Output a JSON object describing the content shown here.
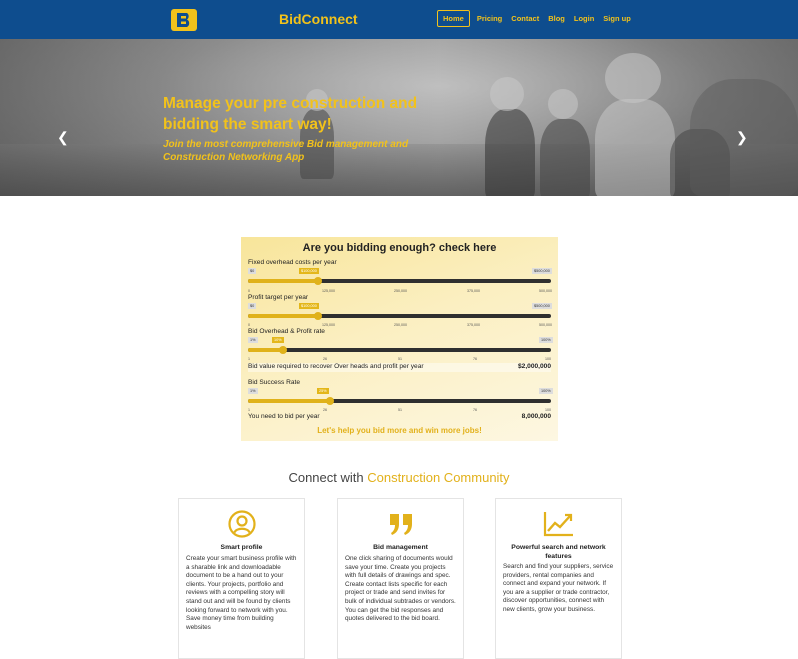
{
  "header": {
    "brand": "BidConnect",
    "nav": [
      "Home",
      "Pricing",
      "Contact",
      "Blog",
      "Login",
      "Sign up"
    ],
    "colors": {
      "navbar": "#0e4d8e",
      "accent": "#f2c21b"
    }
  },
  "hero": {
    "headline": "Manage your pre construction and bidding the smart way!",
    "subline": "Join the most comprehensive Bid management and Construction Networking App",
    "prev_icon": "chevron-left-icon",
    "next_icon": "chevron-right-icon",
    "slides": 2,
    "active_slide": 1
  },
  "calculator": {
    "title": "Are you bidding enough? check here",
    "sliders": [
      {
        "label": "Fixed overhead costs per year",
        "min_label": "$0",
        "max_label": "$500,000",
        "value_label": "$100,000",
        "fraction": 0.2,
        "ticks": [
          "0",
          "125,000",
          "250,000",
          "375,000",
          "500,000"
        ]
      },
      {
        "label": "Profit target per year",
        "min_label": "$0",
        "max_label": "$500,000",
        "value_label": "$100,000",
        "fraction": 0.2,
        "ticks": [
          "0",
          "125,000",
          "250,000",
          "375,000",
          "500,000"
        ]
      },
      {
        "label": "Bid Overhead & Profit rate",
        "min_label": "1%",
        "max_label": "100%",
        "value_label": "10%",
        "fraction": 0.1,
        "ticks": [
          "1",
          "26",
          "51",
          "76",
          "100"
        ]
      }
    ],
    "result1": {
      "label": "Bid value required to recover Over heads and profit per year",
      "value": "$2,000,000"
    },
    "success": {
      "label": "Bid Success Rate",
      "min_label": "1%",
      "max_label": "100%",
      "value_label": "25%",
      "fraction": 0.25,
      "ticks": [
        "1",
        "26",
        "51",
        "76",
        "100"
      ]
    },
    "result2": {
      "label": "You need to bid per year",
      "value": "8,000,000"
    },
    "cta": "Let's help you bid more and win more jobs!"
  },
  "connect": {
    "title_plain": "Connect with ",
    "title_highlight": "Construction Community",
    "cards": [
      {
        "icon": "user-circle-icon",
        "title": "Smart profile",
        "text": "Create your smart business profile with a sharable link and downloadable document to be a hand out to your clients. Your projects, portfolio and reviews with a compelling story will stand out and will be found by clients looking forward to network with you. Save money time from building websites"
      },
      {
        "icon": "quote-icon",
        "title": "Bid management",
        "text": "One click sharing of documents would save your time. Create you projects with full details of drawings and spec. Create contact lists specific for each project or trade and send invites for bulk of individual subtrades or vendors. You can get the bid responses and quotes delivered to the bid board."
      },
      {
        "icon": "line-chart-icon",
        "title": "Powerful search and network features",
        "text": "Search and find your suppliers, service providers, rental companies and connect and expand your network. If you are a supplier or trade contractor, discover opportunities, connect with new clients, grow your business."
      }
    ]
  }
}
